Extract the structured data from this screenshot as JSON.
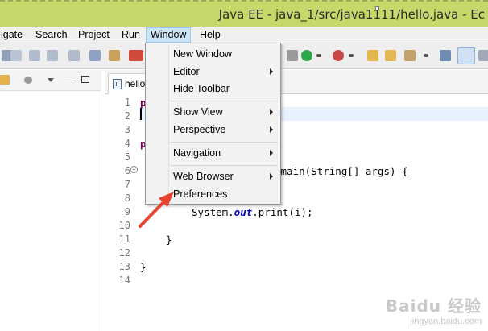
{
  "window": {
    "title": "Java EE - java_1/src/java1111/hello.java - Ec"
  },
  "menubar": {
    "items": [
      "igate",
      "Search",
      "Project",
      "Run",
      "Window",
      "Help"
    ],
    "active": "Window"
  },
  "window_menu": {
    "items": [
      {
        "label": "New Window",
        "submenu": false
      },
      {
        "label": "Editor",
        "submenu": true
      },
      {
        "label": "Hide Toolbar",
        "submenu": false
      },
      {
        "label": "Show View",
        "submenu": true
      },
      {
        "label": "Perspective",
        "submenu": true
      },
      {
        "label": "Navigation",
        "submenu": true
      },
      {
        "label": "Web Browser",
        "submenu": true
      },
      {
        "label": "Preferences",
        "submenu": false
      }
    ]
  },
  "editor": {
    "tab_label": "hello",
    "line_numbers": [
      "1",
      "2",
      "3",
      "4",
      "5",
      "6",
      "7",
      "8",
      "9",
      "10",
      "11",
      "12",
      "13",
      "14"
    ],
    "code": {
      "l1_visible": "p",
      "l4_visible": "p",
      "l6_visible": " main(String[] args) {",
      "l9_prefix": "System.",
      "l9_field": "out",
      "l9_suffix": ".print(i);",
      "l11": "}",
      "l13": "}"
    }
  },
  "colors": {
    "titlebar_bg": "#c6d86a",
    "menu_active_bg": "#cce4f7",
    "annotation_arrow": "#e8432f",
    "keyword": "#7f0055",
    "field": "#0000c0"
  },
  "watermark": {
    "main": "Baidu 经验",
    "sub": "jingyan.baidu.com"
  }
}
